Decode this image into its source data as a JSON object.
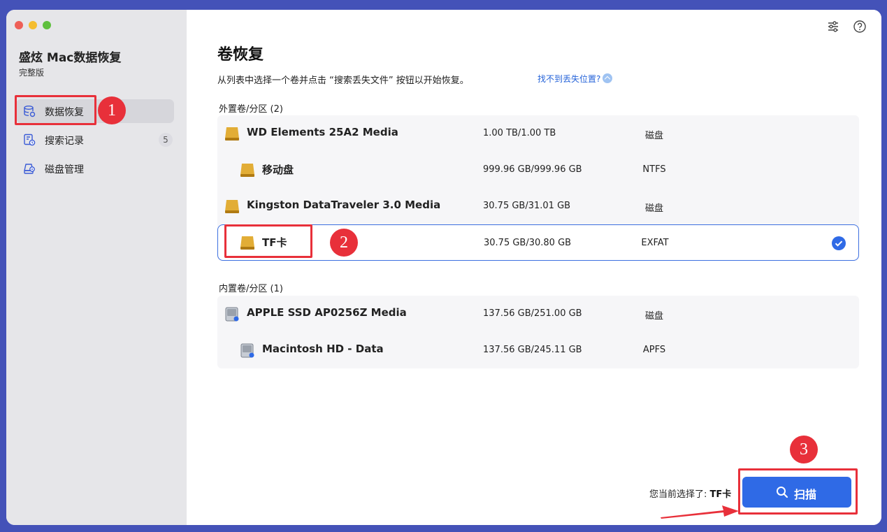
{
  "sidebar": {
    "app_title": "盛炫 Mac数据恢复",
    "edition": "完整版",
    "items": [
      {
        "label": "数据恢复",
        "icon": "database-icon"
      },
      {
        "label": "搜索记录",
        "icon": "history-icon",
        "badge": "5"
      },
      {
        "label": "磁盘管理",
        "icon": "disk-manage-icon"
      }
    ]
  },
  "header": {
    "icons": [
      "settings-sliders-icon",
      "help-icon"
    ],
    "title": "卷恢复",
    "description": "从列表中选择一个卷并点击 “搜索丢失文件” 按钮以开始恢复。",
    "help_link": "找不到丢失位置?"
  },
  "external": {
    "label": "外置卷/分区 (2)",
    "rows": [
      {
        "name": "WD Elements 25A2 Media",
        "size": "1.00 TB/1.00 TB",
        "fs": "磁盘"
      },
      {
        "name": "移动盘",
        "size": "999.96 GB/999.96 GB",
        "fs": "NTFS"
      },
      {
        "name": "Kingston DataTraveler 3.0 Media",
        "size": "30.75 GB/31.01 GB",
        "fs": "磁盘"
      },
      {
        "name": "TF卡",
        "size": "30.75 GB/30.80 GB",
        "fs": "EXFAT",
        "selected": true
      }
    ]
  },
  "internal": {
    "label": "内置卷/分区 (1)",
    "rows": [
      {
        "name": "APPLE SSD AP0256Z Media",
        "size": "137.56 GB/251.00 GB",
        "fs": "磁盘"
      },
      {
        "name": "Macintosh HD - Data",
        "size": "137.56 GB/245.11 GB",
        "fs": "APFS"
      }
    ]
  },
  "footer": {
    "selected_prefix": "您当前选择了: ",
    "selected_value": "TF卡",
    "scan_label": "扫描"
  },
  "annotations": [
    "1",
    "2",
    "3"
  ],
  "colors": {
    "accent": "#2f6ae6",
    "annotation_red": "#e8303a",
    "disk_gold": "#d9a128",
    "frame": "#4452b8"
  }
}
